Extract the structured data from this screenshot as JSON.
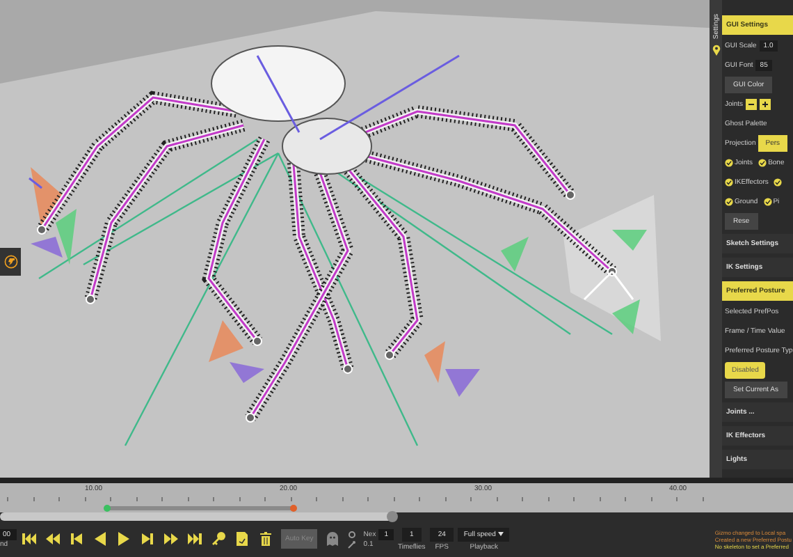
{
  "panel": {
    "tab": "Settings",
    "rows": [
      {
        "kind": "section",
        "label": "GUI Settings",
        "expanded": true
      },
      {
        "kind": "field",
        "label": "GUI Scale",
        "value": "1.0"
      },
      {
        "kind": "field",
        "label": "GUI Font",
        "value": "85"
      },
      {
        "kind": "button",
        "label": "GUI Color"
      },
      {
        "kind": "stepper",
        "label": "Joints"
      },
      {
        "kind": "label",
        "label": "Ghost Palette"
      },
      {
        "kind": "toggle",
        "label": "Projection",
        "option": "Pers"
      },
      {
        "kind": "checks",
        "items": [
          {
            "label": "Joints",
            "checked": true
          },
          {
            "label": "Bone",
            "checked": true
          }
        ]
      },
      {
        "kind": "checks",
        "items": [
          {
            "label": "IKEffectors",
            "checked": true
          },
          {
            "checked": true
          }
        ]
      },
      {
        "kind": "checks",
        "items": [
          {
            "label": "Ground",
            "checked": true
          },
          {
            "label": "Pi",
            "checked": true
          }
        ]
      },
      {
        "kind": "button",
        "label": "Rese"
      },
      {
        "kind": "section",
        "label": "Sketch Settings",
        "expanded": false
      },
      {
        "kind": "section",
        "label": "IK Settings",
        "expanded": false
      },
      {
        "kind": "section",
        "label": "Preferred Posture",
        "expanded": true
      },
      {
        "kind": "label",
        "label": "Selected PrefPos"
      },
      {
        "kind": "label",
        "label": "Frame / Time Value"
      },
      {
        "kind": "label",
        "label": "Preferred Posture Typ"
      },
      {
        "kind": "choice",
        "options": [
          {
            "label": "Disabled",
            "selected": true
          }
        ]
      },
      {
        "kind": "button",
        "label": "Set Current As"
      },
      {
        "kind": "section",
        "label": "Joints ...",
        "expanded": false
      },
      {
        "kind": "section",
        "label": "IK Effectors",
        "expanded": false
      },
      {
        "kind": "section",
        "label": "Lights",
        "expanded": false
      }
    ]
  },
  "timeline": {
    "labels": [
      "10.00",
      "20.00",
      "30.00",
      "40.00"
    ]
  },
  "controls": {
    "time_value": "00",
    "time_caption": "nd",
    "auto_key": "Auto Key",
    "next_label": "Nex",
    "next_value": "1",
    "step_value": "0.1",
    "fields": [
      {
        "value": "1",
        "caption": "Timeflies"
      },
      {
        "value": "24",
        "caption": "FPS"
      }
    ],
    "playback": {
      "value": "Full speed",
      "caption": "Playback"
    }
  },
  "log": [
    {
      "text": "Gizmo changed to Local spa",
      "kind": "info"
    },
    {
      "text": "Created a new Preferred Postu",
      "kind": "info"
    },
    {
      "text": "No skeleton to set a Preferred",
      "kind": "warning"
    }
  ]
}
